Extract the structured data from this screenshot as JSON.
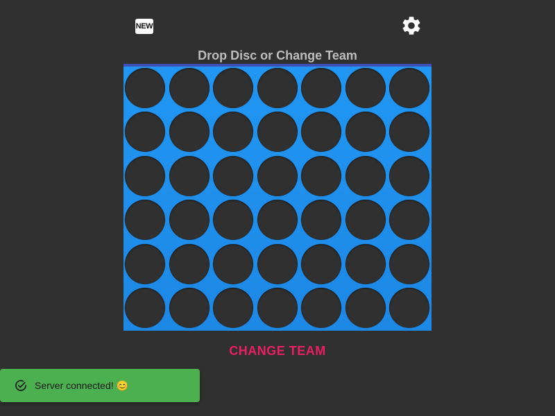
{
  "header": {
    "new_game_label": "NEW",
    "new_game_icon": "new-badge-icon",
    "settings_icon": "gear-icon"
  },
  "status": {
    "title": "Drop Disc or Change Team"
  },
  "board": {
    "rows": 6,
    "columns": 7,
    "background_color": "#2196f3",
    "top_bar_color": "#3f51b5",
    "empty_cell_color": "#303030",
    "cells": [
      [
        "empty",
        "empty",
        "empty",
        "empty",
        "empty",
        "empty",
        "empty"
      ],
      [
        "empty",
        "empty",
        "empty",
        "empty",
        "empty",
        "empty",
        "empty"
      ],
      [
        "empty",
        "empty",
        "empty",
        "empty",
        "empty",
        "empty",
        "empty"
      ],
      [
        "empty",
        "empty",
        "empty",
        "empty",
        "empty",
        "empty",
        "empty"
      ],
      [
        "empty",
        "empty",
        "empty",
        "empty",
        "empty",
        "empty",
        "empty"
      ],
      [
        "empty",
        "empty",
        "empty",
        "empty",
        "empty",
        "empty",
        "empty"
      ]
    ]
  },
  "actions": {
    "change_team_label": "CHANGE TEAM",
    "change_team_color": "#e91e63"
  },
  "toast": {
    "message": "Server connected! 😊",
    "icon": "check-circle-icon",
    "background_color": "#4caf50"
  }
}
